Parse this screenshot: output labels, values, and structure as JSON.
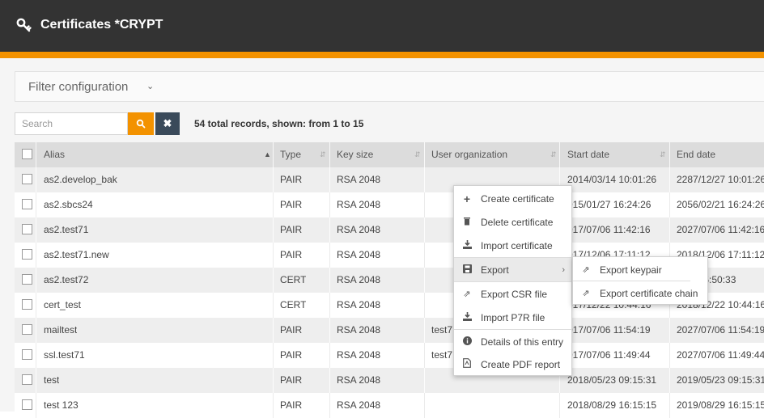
{
  "header": {
    "title": "Certificates *CRYPT",
    "icon": "key-icon",
    "background": "#333333",
    "accent": "#f39200"
  },
  "filter": {
    "label": "Filter configuration"
  },
  "search": {
    "placeholder": "Search",
    "records_text": "54 total records, shown: from 1 to 15"
  },
  "table": {
    "columns": [
      "Alias",
      "Type",
      "Key size",
      "User organization",
      "Start date",
      "End date"
    ],
    "sorted_column": "Alias",
    "rows": [
      {
        "alias": "as2.develop_bak",
        "type": "PAIR",
        "key": "RSA 2048",
        "org": "",
        "start": "2014/03/14 10:01:26",
        "end": "2287/12/27 10:01:26"
      },
      {
        "alias": "as2.sbcs24",
        "type": "PAIR",
        "key": "RSA 2048",
        "org": "",
        "start": "015/01/27 16:24:26",
        "end": "2056/02/21 16:24:26"
      },
      {
        "alias": "as2.test71",
        "type": "PAIR",
        "key": "RSA 2048",
        "org": "",
        "start": "017/07/06 11:42:16",
        "end": "2027/07/06 11:42:16"
      },
      {
        "alias": "as2.test71.new",
        "type": "PAIR",
        "key": "RSA 2048",
        "org": "",
        "start": "017/12/06 17:11:12",
        "end": "2018/12/06 17:11:12"
      },
      {
        "alias": "as2.test72",
        "type": "CERT",
        "key": "RSA 2048",
        "org": "",
        "start": "",
        "end": "5/19 15:50:33"
      },
      {
        "alias": "cert_test",
        "type": "CERT",
        "key": "RSA 2048",
        "org": "",
        "start": "017/12/22 10:44:16",
        "end": "2018/12/22 10:44:16"
      },
      {
        "alias": "mailtest",
        "type": "PAIR",
        "key": "RSA 2048",
        "org": "test7",
        "start": "017/07/06 11:54:19",
        "end": "2027/07/06 11:54:19"
      },
      {
        "alias": "ssl.test71",
        "type": "PAIR",
        "key": "RSA 2048",
        "org": "test7",
        "start": "017/07/06 11:49:44",
        "end": "2027/07/06 11:49:44"
      },
      {
        "alias": "test",
        "type": "PAIR",
        "key": "RSA 2048",
        "org": "",
        "start": "2018/05/23 09:15:31",
        "end": "2019/05/23 09:15:31"
      },
      {
        "alias": "test 123",
        "type": "PAIR",
        "key": "RSA 2048",
        "org": "",
        "start": "2018/08/29 16:15:15",
        "end": "2019/08/29 16:15:15"
      }
    ]
  },
  "context_menu": {
    "items": [
      {
        "label": "Create certificate",
        "icon": "plus-icon"
      },
      {
        "label": "Delete certificate",
        "icon": "trash-icon"
      },
      {
        "label": "Import certificate",
        "icon": "import-icon"
      },
      {
        "label": "Export",
        "icon": "save-icon",
        "has_submenu": true
      },
      {
        "label": "Export CSR file",
        "icon": "external-link-icon"
      },
      {
        "label": "Import P7R file",
        "icon": "import-icon"
      },
      {
        "label": "Details of this entry",
        "icon": "info-icon"
      },
      {
        "label": "Create PDF report",
        "icon": "pdf-icon"
      }
    ],
    "submenu": [
      {
        "label": "Export keypair",
        "icon": "external-link-icon"
      },
      {
        "label": "Export certificate chain",
        "icon": "external-link-icon"
      }
    ]
  }
}
